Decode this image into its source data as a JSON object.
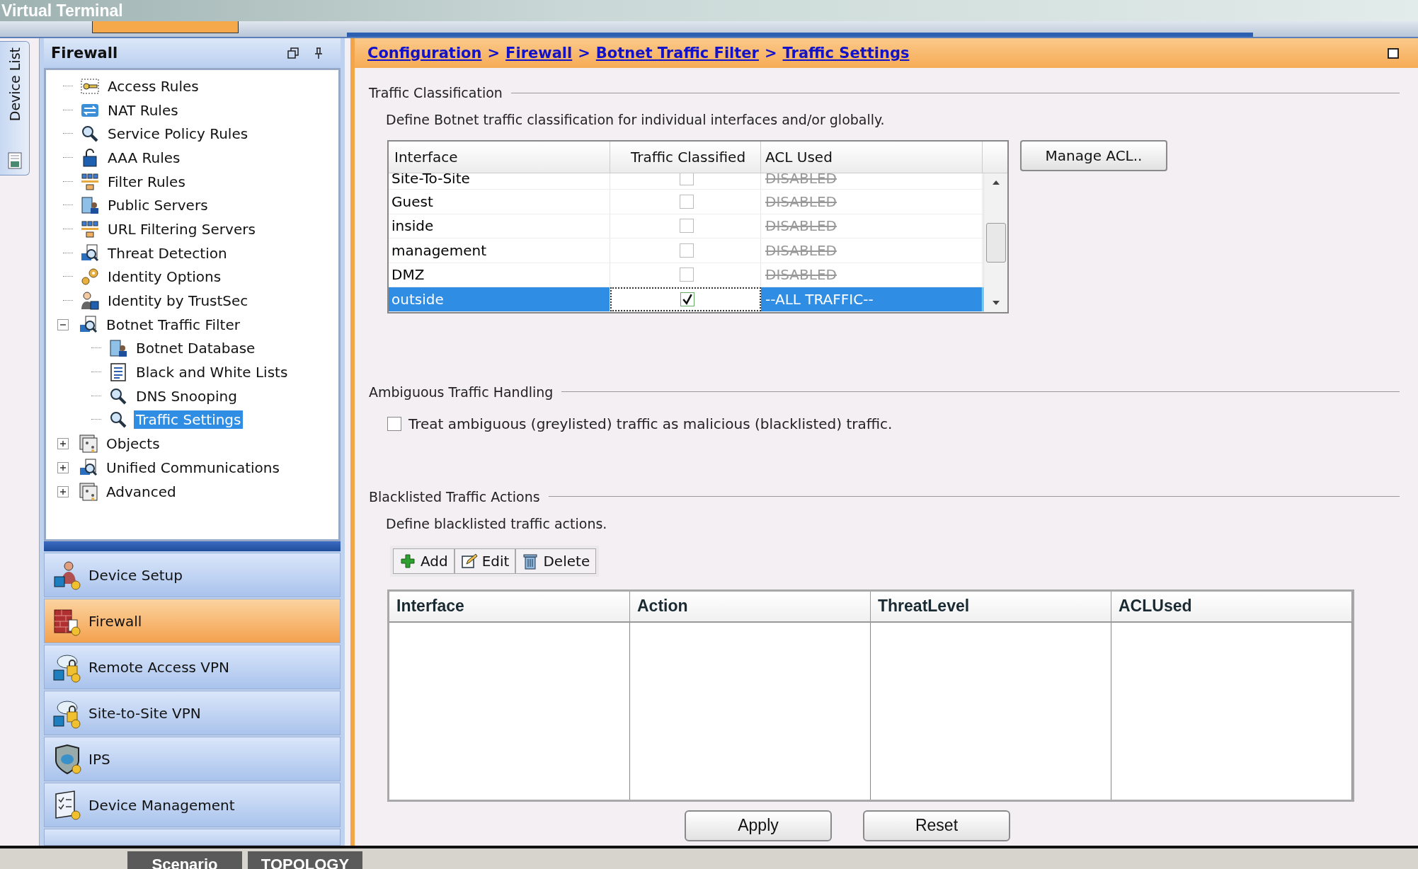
{
  "title_bar": {
    "title": "Virtual Terminal"
  },
  "device_list_tab": {
    "label": "Device List"
  },
  "left_panel": {
    "title": "Firewall",
    "tree": [
      {
        "label": "Access Rules",
        "kind": "key",
        "selected": false
      },
      {
        "label": "NAT Rules",
        "kind": "arrows",
        "selected": false
      },
      {
        "label": "Service Policy Rules",
        "kind": "magnifier",
        "selected": false
      },
      {
        "label": "AAA Rules",
        "kind": "lock",
        "selected": false
      },
      {
        "label": "Filter Rules",
        "kind": "filter",
        "selected": false
      },
      {
        "label": "Public Servers",
        "kind": "server",
        "selected": false
      },
      {
        "label": "URL Filtering Servers",
        "kind": "filter",
        "selected": false
      },
      {
        "label": "Threat Detection",
        "kind": "scan",
        "selected": false
      },
      {
        "label": "Identity Options",
        "kind": "gears",
        "selected": false
      },
      {
        "label": "Identity by TrustSec",
        "kind": "person",
        "selected": false
      },
      {
        "label": "Botnet Traffic Filter",
        "kind": "scan",
        "selected": false,
        "expanded": true,
        "children": [
          {
            "label": "Botnet Database",
            "kind": "server",
            "selected": false
          },
          {
            "label": "Black and White Lists",
            "kind": "list",
            "selected": false
          },
          {
            "label": "DNS Snooping",
            "kind": "magnifier",
            "selected": false
          },
          {
            "label": "Traffic Settings",
            "kind": "magnifier",
            "selected": true
          }
        ]
      },
      {
        "label": "Objects",
        "kind": "objects",
        "selected": false,
        "expanded": false
      },
      {
        "label": "Unified Communications",
        "kind": "scan",
        "selected": false,
        "expanded": false
      },
      {
        "label": "Advanced",
        "kind": "objects",
        "selected": false,
        "expanded": false
      }
    ],
    "nav": [
      {
        "label": "Device Setup",
        "kind": "setup",
        "selected": false
      },
      {
        "label": "Firewall",
        "kind": "wall",
        "selected": true
      },
      {
        "label": "Remote Access VPN",
        "kind": "vpn",
        "selected": false
      },
      {
        "label": "Site-to-Site VPN",
        "kind": "vpn",
        "selected": false
      },
      {
        "label": "IPS",
        "kind": "shield",
        "selected": false
      },
      {
        "label": "Device Management",
        "kind": "checklist",
        "selected": false
      }
    ]
  },
  "breadcrumb": {
    "items": [
      "Configuration",
      "Firewall",
      "Botnet Traffic Filter",
      "Traffic Settings"
    ],
    "separator": ">"
  },
  "traffic_classification": {
    "title": "Traffic Classification",
    "description": "Define Botnet traffic classification for individual interfaces and/or globally.",
    "table": {
      "columns": [
        "Interface",
        "Traffic Classified",
        "ACL Used"
      ],
      "rows": [
        {
          "interface": "Site-To-Site",
          "traffic_classified": false,
          "acl_used": "DISABLED",
          "selected": false
        },
        {
          "interface": "Guest",
          "traffic_classified": false,
          "acl_used": "DISABLED",
          "selected": false
        },
        {
          "interface": "inside",
          "traffic_classified": false,
          "acl_used": "DISABLED",
          "selected": false
        },
        {
          "interface": "management",
          "traffic_classified": false,
          "acl_used": "DISABLED",
          "selected": false
        },
        {
          "interface": "DMZ",
          "traffic_classified": false,
          "acl_used": "DISABLED",
          "selected": false
        },
        {
          "interface": "outside",
          "traffic_classified": true,
          "acl_used": "--ALL TRAFFIC--",
          "selected": true
        }
      ]
    },
    "manage_button": "Manage ACL.."
  },
  "ambiguous": {
    "title": "Ambiguous Traffic Handling",
    "option": {
      "label": "Treat ambiguous (greylisted) traffic as malicious (blacklisted) traffic.",
      "checked": false
    }
  },
  "blacklisted": {
    "title": "Blacklisted Traffic Actions",
    "description": "Define blacklisted traffic actions.",
    "toolbar": [
      {
        "label": "Add",
        "kind": "add"
      },
      {
        "label": "Edit",
        "kind": "edit"
      },
      {
        "label": "Delete",
        "kind": "delete"
      }
    ],
    "table": {
      "columns": [
        "Interface",
        "Action",
        "ThreatLevel",
        "ACLUsed"
      ]
    }
  },
  "buttons": [
    "Apply",
    "Reset"
  ],
  "bottom_tabs": [
    "Scenario",
    "TOPOLOGY"
  ]
}
